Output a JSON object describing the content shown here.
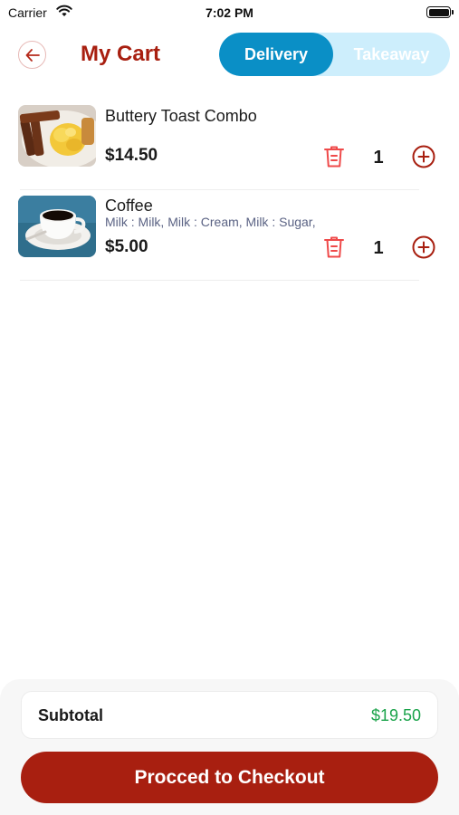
{
  "status_bar": {
    "carrier": "Carrier",
    "time": "7:02 PM"
  },
  "header": {
    "title": "My Cart",
    "delivery_toggle": {
      "options": [
        "Delivery",
        "Takeaway"
      ],
      "selected": "Delivery"
    }
  },
  "cart": {
    "items": [
      {
        "name": "Buttery Toast Combo",
        "options": "",
        "price": "$14.50",
        "quantity": "1",
        "image_icon": "toast-eggs-photo"
      },
      {
        "name": "Coffee",
        "options": "Milk : Milk, Milk : Cream, Milk : Sugar,",
        "price": "$5.00",
        "quantity": "1",
        "image_icon": "coffee-cup-photo"
      }
    ]
  },
  "summary": {
    "subtotal_label": "Subtotal",
    "subtotal_value": "$19.50"
  },
  "checkout": {
    "label": "Procced to Checkout"
  },
  "colors": {
    "brand_red": "#a81f10",
    "accent_blue": "#0a8fc6",
    "toggle_bg": "#cdeefc",
    "subtotal_green": "#1aa34a"
  }
}
